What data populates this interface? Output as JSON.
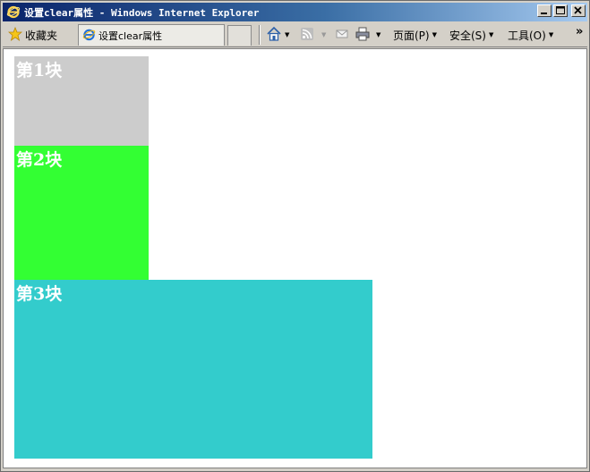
{
  "window": {
    "title": "设置clear属性 - Windows Internet Explorer"
  },
  "toolbar": {
    "favorites_label": "收藏夹",
    "tab_title": "设置clear属性",
    "page_menu": "页面(P)",
    "safety_menu": "安全(S)",
    "tools_menu": "工具(O)",
    "overflow": "»"
  },
  "content": {
    "blocks": [
      {
        "label": "第1块",
        "color": "#cccccc"
      },
      {
        "label": "第2块",
        "color": "#33ff33"
      },
      {
        "label": "第3块",
        "color": "#33cccc"
      }
    ]
  }
}
